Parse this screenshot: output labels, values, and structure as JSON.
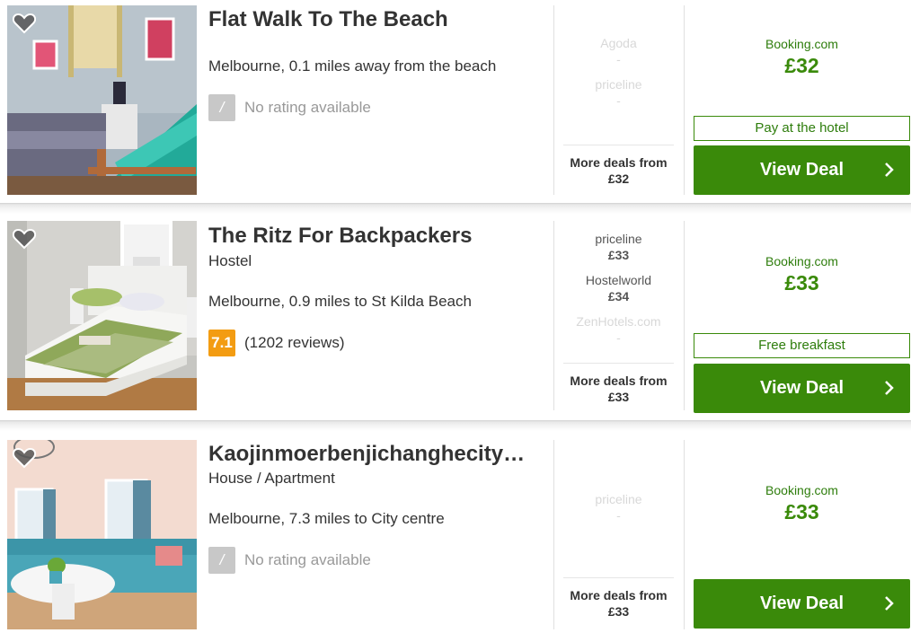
{
  "listings": [
    {
      "title": "Flat Walk To The Beach",
      "subtype": "",
      "location": "Melbourne, 0.1 miles away from the beach",
      "rating": {
        "score": "/",
        "text": "No rating available",
        "style": "none"
      },
      "deals": [
        {
          "site": "Agoda",
          "price": "-",
          "faded": true
        },
        {
          "site": "priceline",
          "price": "-",
          "faded": true
        }
      ],
      "more_deals": {
        "label": "More deals from",
        "price": "£32"
      },
      "best": {
        "site": "Booking.com",
        "price": "£32",
        "perk": "Pay at the hotel",
        "button": "View Deal"
      }
    },
    {
      "title": "The Ritz For Backpackers",
      "subtype": "Hostel",
      "location": "Melbourne, 0.9 miles to St Kilda Beach",
      "rating": {
        "score": "7.1",
        "text": "(1202 reviews)",
        "style": "orange"
      },
      "deals": [
        {
          "site": "priceline",
          "price": "£33",
          "faded": false
        },
        {
          "site": "Hostelworld",
          "price": "£34",
          "faded": false
        },
        {
          "site": "ZenHotels.com",
          "price": "-",
          "faded": true
        }
      ],
      "more_deals": {
        "label": "More deals from",
        "price": "£33"
      },
      "best": {
        "site": "Booking.com",
        "price": "£33",
        "perk": "Free breakfast",
        "button": "View Deal"
      }
    },
    {
      "title": "Kaojinmoerbenjichanghecity…",
      "subtype": "House / Apartment",
      "location": "Melbourne, 7.3 miles to City centre",
      "rating": {
        "score": "/",
        "text": "No rating available",
        "style": "none"
      },
      "deals": [
        {
          "site": "priceline",
          "price": "-",
          "faded": true
        }
      ],
      "more_deals": {
        "label": "More deals from",
        "price": "£33"
      },
      "best": {
        "site": "Booking.com",
        "price": "£33",
        "perk": "",
        "button": "View Deal"
      }
    }
  ],
  "colors": {
    "green": "#3a8a0a",
    "orange": "#f39c12",
    "grey_badge": "#c8c8c8"
  },
  "icons": {
    "favorite": "heart-icon",
    "button": "chevron-right-icon"
  }
}
